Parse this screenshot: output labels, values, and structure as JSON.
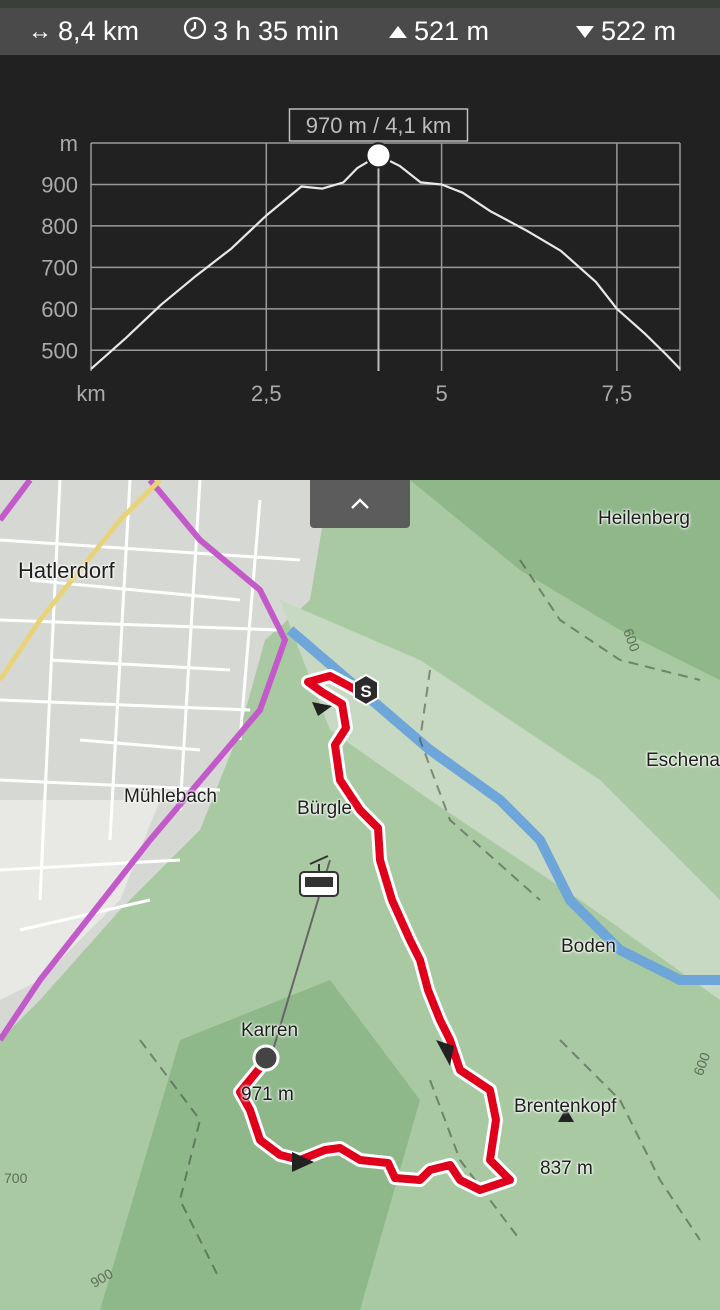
{
  "stats": {
    "distance": "8,4 km",
    "duration": "3 h 35 min",
    "ascent": "521 m",
    "descent": "522 m",
    "icons": {
      "distance": "horizontal-arrow-icon",
      "duration": "clock-icon",
      "ascent": "triangle-up-icon",
      "descent": "triangle-down-icon"
    }
  },
  "chart_data": {
    "type": "area",
    "title": "",
    "xlabel": "km",
    "ylabel": "m",
    "x_ticks": [
      "2,5",
      "5",
      "7,5"
    ],
    "y_ticks": [
      "900",
      "800",
      "700",
      "600",
      "500"
    ],
    "xlim": [
      0,
      8.4
    ],
    "ylim": [
      450,
      1000
    ],
    "grid": true,
    "cursor_label": "970 m / 4,1 km",
    "cursor": {
      "x": 4.1,
      "y": 970
    },
    "series": [
      {
        "x": [
          0,
          0.5,
          1.0,
          1.5,
          2.0,
          2.5,
          3.0,
          3.3,
          3.6,
          3.8,
          4.1,
          4.4,
          4.7,
          5.0,
          5.3,
          5.7,
          6.2,
          6.7,
          7.2,
          7.5,
          7.9,
          8.2,
          8.4
        ],
        "values": [
          455,
          530,
          610,
          680,
          745,
          825,
          895,
          890,
          905,
          940,
          970,
          945,
          905,
          900,
          880,
          835,
          790,
          740,
          665,
          600,
          540,
          490,
          455
        ]
      }
    ],
    "colors": {
      "line": "#e8e8e8",
      "grid": "#9a9a9a",
      "axis_text": "#aaaaaa"
    }
  },
  "map": {
    "collapse_button": "chevron-up-icon",
    "labels": {
      "hatlerdorf": "Hatlerdorf",
      "muehlebach": "Mühlebach",
      "buergle": "Bürgle",
      "heilenberg": "Heilenberg",
      "eschenau": "Eschenau",
      "boden": "Boden",
      "karren": "Karren",
      "karren_elev": "971 m",
      "brentenkopf": "Brentenkopf",
      "brentenkopf_elev": "837 m",
      "contour_600a": "600",
      "contour_600b": "600",
      "contour_900": "900",
      "contour_700": "700"
    },
    "start_marker": "S",
    "colors": {
      "route": "#e0001b",
      "forest": "#a9c9a3",
      "urban": "#d9dcd6",
      "river": "#6fa6d9",
      "rail": "#c35ac9"
    }
  }
}
